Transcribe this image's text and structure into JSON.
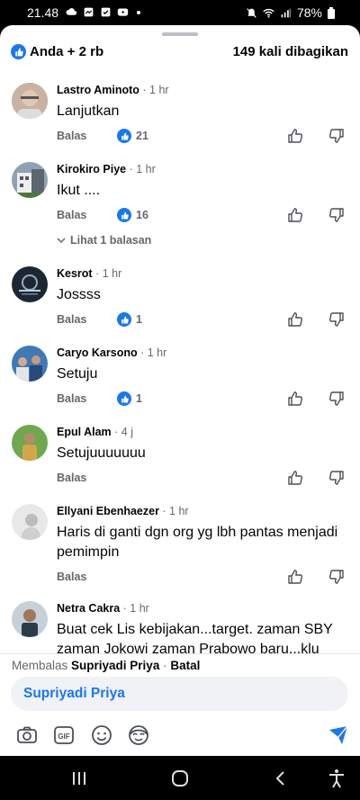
{
  "status_bar": {
    "time": "21.48",
    "battery": "78%"
  },
  "header": {
    "reactions": "Anda + 2 rb",
    "shares": "149 kali dibagikan"
  },
  "comments": [
    {
      "name": "Lastro Aminoto",
      "time": "1 hr",
      "text": "Lanjutkan",
      "reply": "Balas",
      "likes": "21",
      "avatar_color": "#b89a86"
    },
    {
      "name": "Kirokiro Piye",
      "time": "1 hr",
      "text": "Ikut ....",
      "reply": "Balas",
      "likes": "16",
      "view_replies": "Lihat 1 balasan",
      "avatar_color": "#6f7a84"
    },
    {
      "name": "Kesrot",
      "time": "1 hr",
      "text": "Jossss",
      "reply": "Balas",
      "likes": "1",
      "avatar_color": "#1c2733"
    },
    {
      "name": "Caryo Karsono",
      "time": "1 hr",
      "text": "Setuju",
      "reply": "Balas",
      "likes": "1",
      "avatar_color": "#3d7bb8"
    },
    {
      "name": "Epul Alam",
      "time": "4 j",
      "text": "Setujuuuuuuu",
      "reply": "Balas",
      "avatar_color": "#6ea84f"
    },
    {
      "name": "Ellyani Ebenhaezer",
      "time": "1 hr",
      "text": "Haris di ganti dgn org yg lbh pantas menjadi pemimpin",
      "reply": "Balas",
      "avatar_color": "#d8d8d8"
    },
    {
      "name": "Netra Cakra",
      "time": "1 hr",
      "text": "Buat cek Lis kebijakan...target. zaman SBY zaman Jokowi zaman Prabowo baru...klu",
      "avatar_color": "#8a9aa8"
    }
  ],
  "reply_bar": {
    "replying_prefix": "Membalas ",
    "replying_to": "Supriyadi Priya",
    "separator": " · ",
    "cancel": "Batal",
    "mention": "Supriyadi Priya"
  },
  "toolbar_icons": [
    "camera-icon",
    "gif-icon",
    "emoji-icon",
    "avatar-sticker-icon",
    "send-icon"
  ],
  "colors": {
    "accent": "#1877f2",
    "muted_text": "#65676b",
    "input_bg": "#f0f2f5"
  }
}
